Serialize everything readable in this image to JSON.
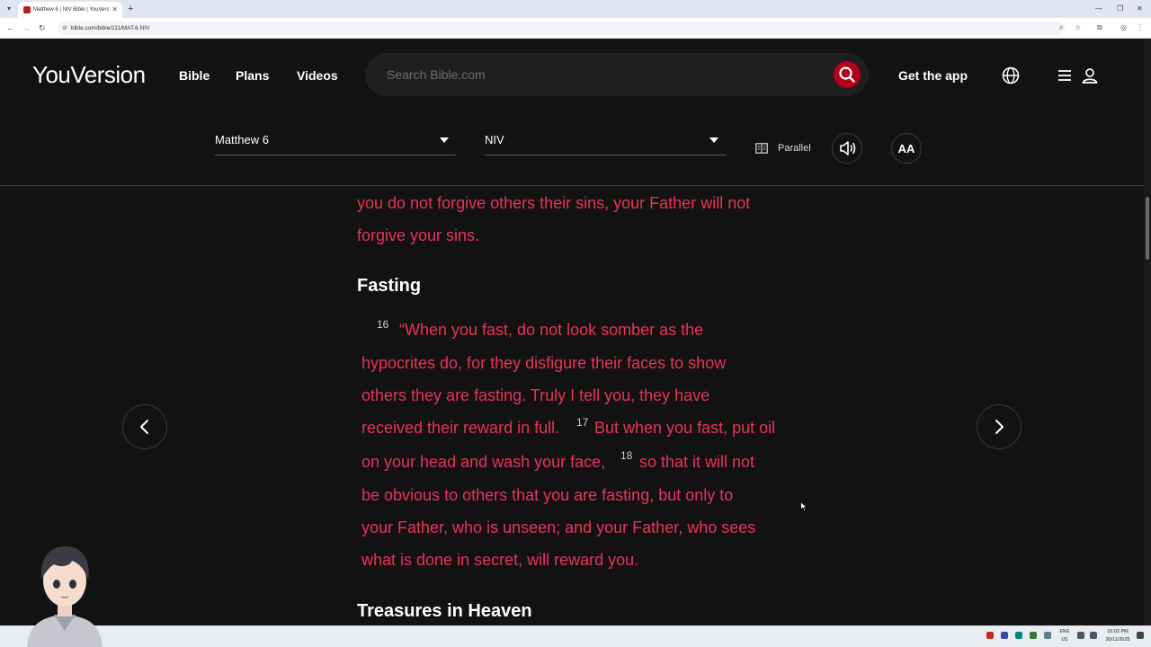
{
  "browser": {
    "tab_title": "Matthew 6 | NIV Bible | YouVersi",
    "url": "bible.com/bible/111/MAT.6.NIV"
  },
  "header": {
    "logo": "YouVersion",
    "nav": [
      "Bible",
      "Plans",
      "Videos"
    ],
    "search_placeholder": "Search Bible.com",
    "get_app": "Get the app"
  },
  "reader": {
    "book_chapter": "Matthew 6",
    "version": "NIV",
    "parallel_label": "Parallel",
    "font_label": "AA"
  },
  "content": {
    "lines_before": [
      "you do not forgive others their sins, your Father will not",
      "forgive your sins."
    ],
    "heading_fasting": "Fasting",
    "v16_num": "16",
    "v16_line1": "“When you fast, do not look somber as the",
    "v16_line2": "hypocrites do, for they disfigure their faces to show",
    "v16_line3": "others they are fasting. Truly I tell you, they have",
    "v16_line4a": "received their reward in full.",
    "v17_num": "17",
    "v17_line4b": "But when you fast, put oil",
    "v17_line5a": "on your head and wash your face,",
    "v18_num": "18",
    "v18_line5b": "so that it will not",
    "v18_line6": "be obvious to others that you are fasting, but only to",
    "v18_line7": "your Father, who is unseen; and your Father, who sees",
    "v18_line8": "what is done in secret, will reward you.",
    "heading_treasures": "Treasures in Heaven"
  },
  "taskbar": {
    "lang_line1": "ENG",
    "lang_line2": "US",
    "time": "10:02 PM",
    "date": "30/11/2025"
  },
  "colors": {
    "background": "#121212",
    "verse_text": "#e8335a",
    "search_button": "#b3001b"
  }
}
